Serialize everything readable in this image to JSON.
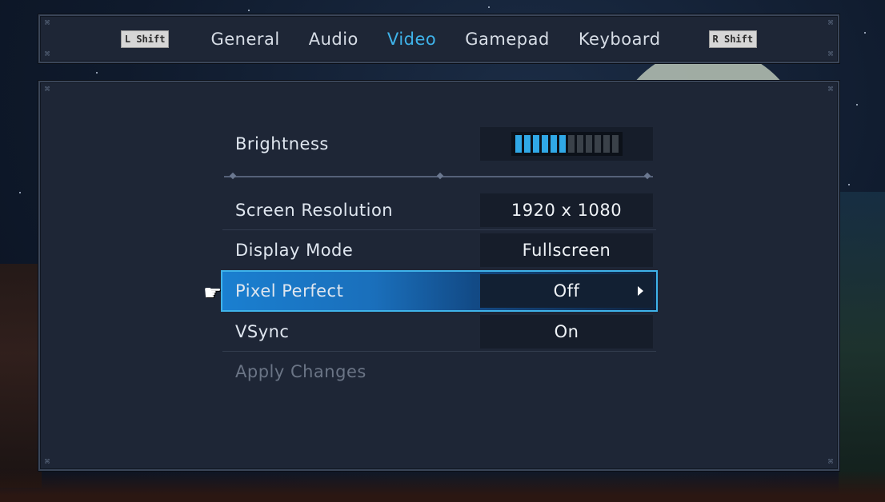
{
  "tabs": {
    "left_key": "L Shift",
    "right_key": "R Shift",
    "items": [
      "General",
      "Audio",
      "Video",
      "Gamepad",
      "Keyboard"
    ],
    "active": "Video"
  },
  "video": {
    "brightness": {
      "label": "Brightness",
      "level": 6,
      "max": 12
    },
    "resolution": {
      "label": "Screen Resolution",
      "value": "1920 x 1080"
    },
    "display_mode": {
      "label": "Display Mode",
      "value": "Fullscreen"
    },
    "pixel_perfect": {
      "label": "Pixel Perfect",
      "value": "Off"
    },
    "vsync": {
      "label": "VSync",
      "value": "On"
    },
    "apply": {
      "label": "Apply Changes"
    }
  },
  "colors": {
    "accent": "#3fb3ea",
    "panel": "#1e2636",
    "meter_on": "#30a8e6",
    "meter_off": "#3a4149"
  },
  "icons": {
    "corner": "ornament-icon",
    "pointer": "pointing-hand-icon",
    "selector_arrow": "arrow-right-icon"
  }
}
